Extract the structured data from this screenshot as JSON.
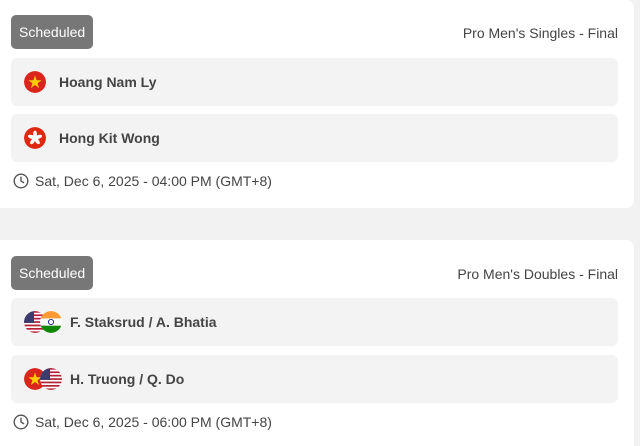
{
  "matches": [
    {
      "status": "Scheduled",
      "event": "Pro Men's Singles - Final",
      "players": [
        {
          "name": "Hoang Nam Ly",
          "flags": [
            "vietnam-flag-icon"
          ]
        },
        {
          "name": "Hong Kit Wong",
          "flags": [
            "hong-kong-flag-icon"
          ]
        }
      ],
      "time": "Sat, Dec 6, 2025 - 04:00 PM (GMT+8)"
    },
    {
      "status": "Scheduled",
      "event": "Pro Men's Doubles - Final",
      "players": [
        {
          "name": "F. Staksrud / A. Bhatia",
          "flags": [
            "usa-flag-icon",
            "india-flag-icon"
          ]
        },
        {
          "name": "H. Truong / Q. Do",
          "flags": [
            "vietnam-flag-icon",
            "usa-flag-icon"
          ]
        }
      ],
      "time": "Sat, Dec 6, 2025 - 06:00 PM (GMT+8)"
    }
  ],
  "colors": {
    "badge": "#777777",
    "row_background": "#f3f3f3",
    "page_background": "#f2f2f2",
    "vietnam_red": "#da251d",
    "vietnam_star": "#ffcd00",
    "hong_kong_red": "#de2910",
    "usa_red": "#b22234",
    "usa_blue": "#3c3b6e",
    "india_saffron": "#ff9933",
    "india_green": "#138808",
    "india_chakra": "#000080"
  }
}
